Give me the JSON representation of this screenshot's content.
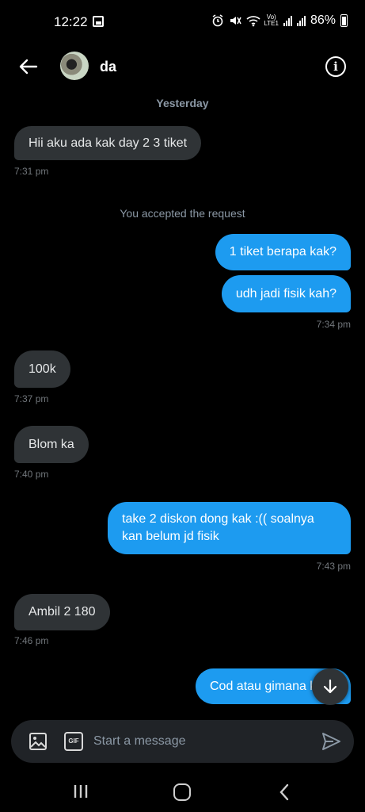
{
  "status_bar": {
    "time": "12:22",
    "volte": "Vo)",
    "lte": "LTE1",
    "battery": "86%"
  },
  "header": {
    "contact_name": "da"
  },
  "conversation": {
    "day_label": "Yesterday",
    "system_note": "You accepted the request",
    "messages": [
      {
        "dir": "in",
        "text": "Hii aku ada kak day 2 3 tiket",
        "time": "7:31 pm"
      },
      {
        "dir": "out",
        "text": "1 tiket berapa kak?"
      },
      {
        "dir": "out",
        "text": "udh jadi fisik kah?",
        "time": "7:34 pm"
      },
      {
        "dir": "in",
        "text": "100k",
        "time": "7:37 pm"
      },
      {
        "dir": "in",
        "text": "Blom ka",
        "time": "7:40 pm"
      },
      {
        "dir": "out",
        "text": "take 2 diskon dong kak :(( soalnya kan belum jd fisik",
        "time": "7:43 pm"
      },
      {
        "dir": "in",
        "text": "Ambil 2 180",
        "time": "7:46 pm"
      },
      {
        "dir": "out",
        "text": "Cod atau gimana k"
      }
    ]
  },
  "composer": {
    "gif_label": "GIF",
    "placeholder": "Start a message"
  },
  "colors": {
    "background": "#000000",
    "incoming_bubble": "#2f3336",
    "outgoing_bubble": "#1d9bf0",
    "muted_text": "#71767b"
  }
}
